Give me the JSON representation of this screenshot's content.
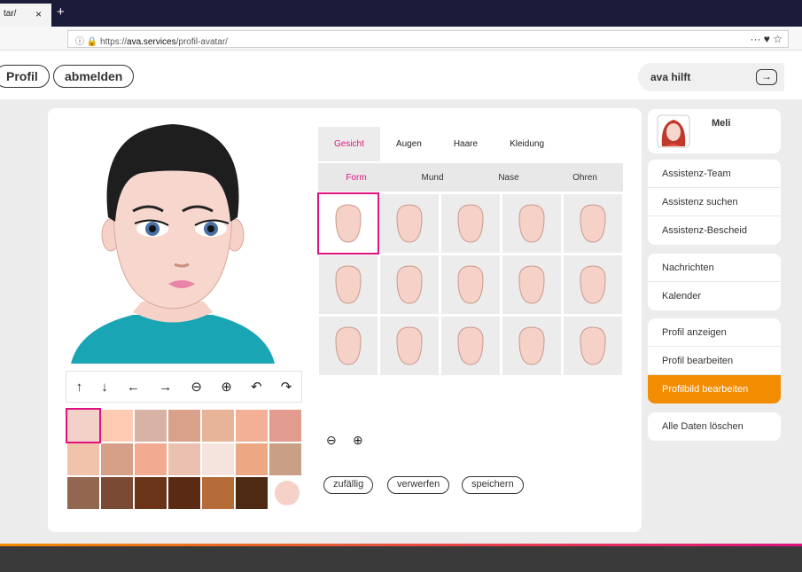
{
  "browser": {
    "tab_title": "tar/",
    "close": "×",
    "newtab": "+",
    "url_prefix": "https://",
    "url_domain": "ava.services",
    "url_path": "/profil-avatar/",
    "icons": "··· ♥ ☆"
  },
  "header": {
    "profil": "Profil",
    "abmelden": "abmelden",
    "help": "ava hilft",
    "help_arrow": "→"
  },
  "editor": {
    "tabs": [
      "Gesicht",
      "Augen",
      "Haare",
      "Kleidung"
    ],
    "subtabs": [
      "Form",
      "Mund",
      "Nase",
      "Ohren"
    ],
    "tools": [
      "↑",
      "↓",
      "←",
      "→",
      "⊖",
      "⊕",
      "↶",
      "↷"
    ],
    "colors": [
      "#f2d1c8",
      "#ffcbb3",
      "#d9b2a6",
      "#d9a08a",
      "#e8b497",
      "#f3b096",
      "#e19c8f",
      "#f1c3ab",
      "#d6a088",
      "#f2aa91",
      "#ebc0b1",
      "#f5e3de",
      "#eba882",
      "#c9a085",
      "#93674f",
      "#7b4a34",
      "#6a3419",
      "#5a2a14",
      "#b66c39",
      "#4f2a13",
      "#f5d1c8"
    ],
    "zoom_out": "⊖",
    "zoom_in": "⊕",
    "buttons": [
      "zufällig",
      "verwerfen",
      "speichern"
    ]
  },
  "sidebar": {
    "user": "Meli",
    "groups": [
      [
        "Assistenz-Team",
        "Assistenz suchen",
        "Assistenz-Bescheid"
      ],
      [
        "Nachrichten",
        "Kalender"
      ],
      [
        "Profil anzeigen",
        "Profil bearbeiten",
        "Profilbild bearbeiten"
      ],
      [
        "Alle Daten löschen"
      ]
    ],
    "active": "Profilbild bearbeiten"
  }
}
